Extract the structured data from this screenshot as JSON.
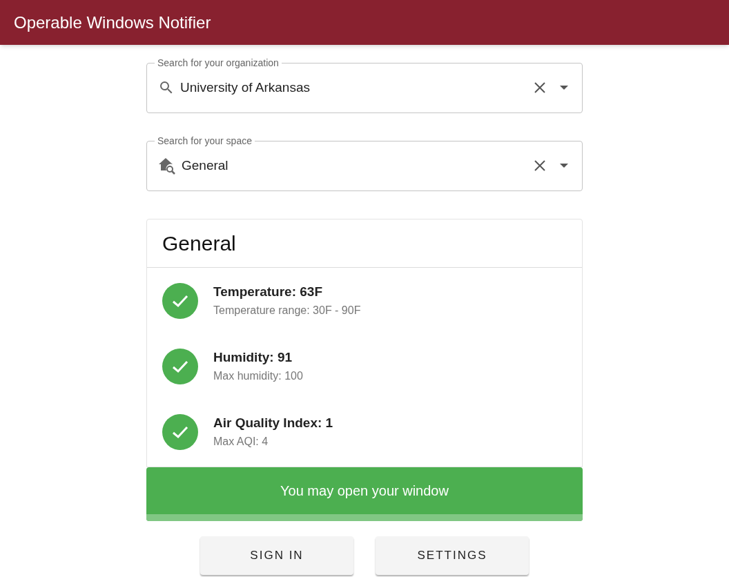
{
  "app_bar": {
    "title": "Operable Windows Notifier"
  },
  "fields": [
    {
      "kind": "search",
      "label": "Search for your organization",
      "value": "University of Arkansas"
    },
    {
      "kind": "space",
      "label": "Search for your space",
      "value": "General"
    }
  ],
  "card": {
    "title": "General",
    "metrics": [
      {
        "ok": true,
        "primary": "Temperature: 63F",
        "secondary": "Temperature range: 30F - 90F"
      },
      {
        "ok": true,
        "primary": "Humidity: 91",
        "secondary": "Max humidity: 100"
      },
      {
        "ok": true,
        "primary": "Air Quality Index: 1",
        "secondary": "Max AQI: 4"
      }
    ]
  },
  "banner": {
    "ok": true,
    "text": "You may open your window"
  },
  "buttons": [
    "SIGN IN",
    "SETTINGS"
  ]
}
